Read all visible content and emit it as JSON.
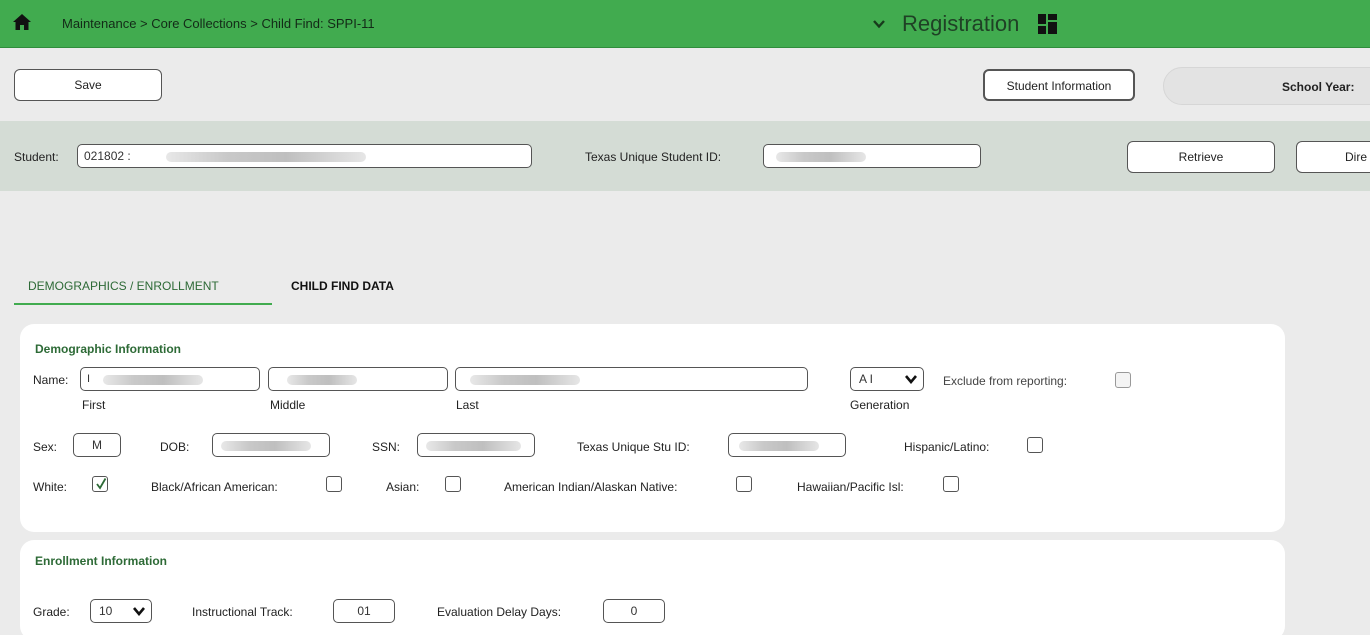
{
  "topbar": {
    "breadcrumb": "Maintenance > Core Collections > Child Find: SPPI-11",
    "app_title": "Registration"
  },
  "toolbar": {
    "save_label": "Save",
    "student_info_label": "Student Information",
    "school_year_label": "School Year:"
  },
  "student_bar": {
    "student_label": "Student:",
    "student_value": "021802 :",
    "tsid_label": "Texas Unique Student ID:",
    "retrieve_label": "Retrieve",
    "directory_label": "Dire"
  },
  "tabs": [
    {
      "label": "DEMOGRAPHICS / ENROLLMENT",
      "active": true
    },
    {
      "label": "CHILD FIND DATA",
      "active": false
    }
  ],
  "demographics": {
    "title": "Demographic Information",
    "name_label": "Name:",
    "first_value": "I",
    "first_caption": "First",
    "middle_caption": "Middle",
    "last_caption": "Last",
    "generation_value": "A I",
    "generation_caption": "Generation",
    "exclude_label": "Exclude from reporting:",
    "sex_label": "Sex:",
    "sex_value": "M",
    "dob_label": "DOB:",
    "ssn_label": "SSN:",
    "tsid_label": "Texas Unique Stu ID:",
    "hispanic_label": "Hispanic/Latino:",
    "white_label": "White:",
    "white_checked": true,
    "black_label": "Black/African American:",
    "asian_label": "Asian:",
    "amind_label": "American Indian/Alaskan Native:",
    "hawaiian_label": "Hawaiian/Pacific Isl:"
  },
  "enrollment": {
    "title": "Enrollment Information",
    "grade_label": "Grade:",
    "grade_value": "10",
    "track_label": "Instructional Track:",
    "track_value": "01",
    "delay_label": "Evaluation Delay Days:",
    "delay_value": "0"
  },
  "colors": {
    "header_green": "#41ab4f",
    "accent_green": "#2d6a36",
    "student_band": "#d4dcd5"
  }
}
